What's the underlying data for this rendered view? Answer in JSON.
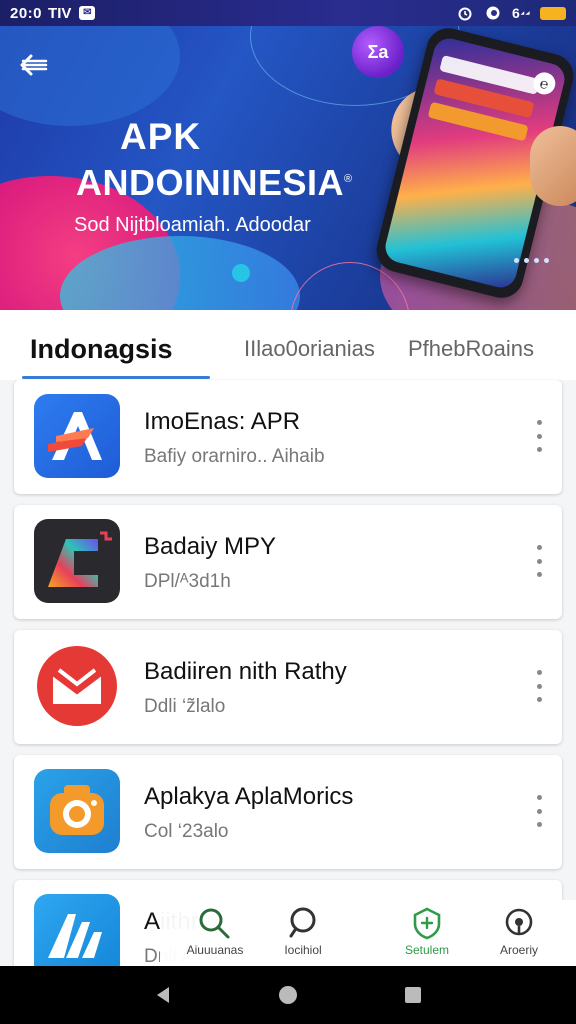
{
  "status_bar": {
    "time": "20:0",
    "carrier": "TIV",
    "notification_glyph": "✉",
    "signal_text": "6"
  },
  "hero": {
    "title": "APK",
    "brand": "ANDOININESIA",
    "brand_mark": "®",
    "subtitle": "Sod Nijtbloamiah. Adoodar",
    "badge_text": "Ʃa",
    "phone_corner_text": "℮"
  },
  "tabs": [
    {
      "label": "Indonagsis",
      "active": true
    },
    {
      "label": "IIlao0orianias",
      "active": false
    },
    {
      "label": "PfhebRoains",
      "active": false
    }
  ],
  "apps": [
    {
      "name": "ImoEnas: APR",
      "subtitle": "Bafiy orarniro.. Aihaib",
      "icon": "red-a-arrow-icon"
    },
    {
      "name": "Badaiy MPY",
      "subtitle": "DPl/ᴬ3d1h",
      "icon": "rainbow-c-icon"
    },
    {
      "name": "Badiiren nith Rathy",
      "subtitle": "Ddli ‘z̃lalo",
      "icon": "red-mail-icon"
    },
    {
      "name": "Aplakya AplaMorics",
      "subtitle": "Col ‘23alo",
      "icon": "orange-camera-icon"
    },
    {
      "name": "Aiithr",
      "subtitle": "Dnli /",
      "icon": "white-m-logo-icon"
    }
  ],
  "bottom_nav": [
    {
      "label": "Aiuuuanas",
      "icon": "search-icon",
      "active": false
    },
    {
      "label": "Iocihiol",
      "icon": "search-icon",
      "active": false
    },
    {
      "label": "Setulem",
      "icon": "shield-icon",
      "active": true
    },
    {
      "label": "Aroeriy",
      "icon": "settings-icon",
      "active": false
    }
  ],
  "colors": {
    "accent": "#3a7bd5",
    "active_nav": "#2e9b46",
    "hero_bg": "#1e3aa8"
  }
}
